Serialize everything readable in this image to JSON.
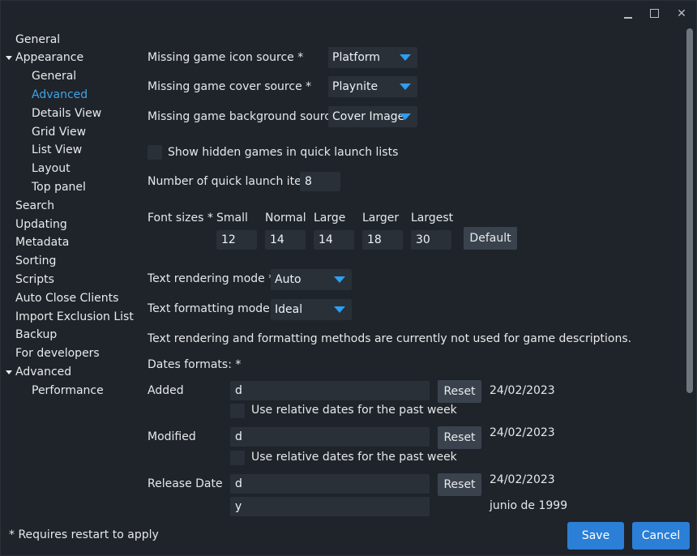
{
  "window": {
    "minimize_icon": "minimize-icon",
    "maximize_icon": "maximize-icon",
    "close_icon": "close-icon",
    "close_glyph": "✕"
  },
  "sidebar": {
    "items": [
      {
        "label": "General"
      },
      {
        "label": "Appearance"
      },
      {
        "label": "General"
      },
      {
        "label": "Advanced"
      },
      {
        "label": "Details View"
      },
      {
        "label": "Grid View"
      },
      {
        "label": "List View"
      },
      {
        "label": "Layout"
      },
      {
        "label": "Top panel"
      },
      {
        "label": "Search"
      },
      {
        "label": "Updating"
      },
      {
        "label": "Metadata"
      },
      {
        "label": "Sorting"
      },
      {
        "label": "Scripts"
      },
      {
        "label": "Auto Close Clients"
      },
      {
        "label": "Import Exclusion List"
      },
      {
        "label": "Backup"
      },
      {
        "label": "For developers"
      },
      {
        "label": "Advanced"
      },
      {
        "label": "Performance"
      }
    ]
  },
  "settings": {
    "icon_source_label": "Missing game icon source *",
    "icon_source_value": "Platform",
    "cover_source_label": "Missing game cover source *",
    "cover_source_value": "Playnite",
    "background_source_label": "Missing game background source *",
    "background_source_value": "Cover Image",
    "show_hidden_label": "Show hidden games in quick launch lists",
    "quick_launch_label": "Number of quick launch items",
    "quick_launch_value": "8",
    "font_sizes_label": "Font sizes *",
    "font_sizes": [
      {
        "name": "Small",
        "value": "12"
      },
      {
        "name": "Normal",
        "value": "14"
      },
      {
        "name": "Large",
        "value": "14"
      },
      {
        "name": "Larger",
        "value": "18"
      },
      {
        "name": "Largest",
        "value": "30"
      }
    ],
    "default_button": "Default",
    "text_rendering_label": "Text rendering mode *",
    "text_rendering_value": "Auto",
    "text_formatting_label": "Text formatting mode *",
    "text_formatting_value": "Ideal",
    "rendering_note": "Text rendering and formatting methods are currently not used for game descriptions.",
    "dates_formats_label": "Dates formats: *",
    "added_label": "Added",
    "added_format": "d",
    "added_reset": "Reset",
    "added_preview": "24/02/2023",
    "added_relative_label": "Use relative dates for the past week",
    "modified_label": "Modified",
    "modified_format": "d",
    "modified_reset": "Reset",
    "modified_preview": "24/02/2023",
    "modified_relative_label": "Use relative dates for the past week",
    "release_label": "Release Date",
    "release_format": "d",
    "release_reset": "Reset",
    "release_preview": "24/02/2023",
    "release_format2": "y",
    "release_preview2": "junio de 1999"
  },
  "footer": {
    "restart_note": "* Requires restart to apply",
    "save_button": "Save",
    "cancel_button": "Cancel"
  },
  "colors": {
    "accent": "#2e9ef0",
    "active_nav": "#3fa4e8",
    "primary_button": "#2b7fd6",
    "background": "#1f242a"
  }
}
